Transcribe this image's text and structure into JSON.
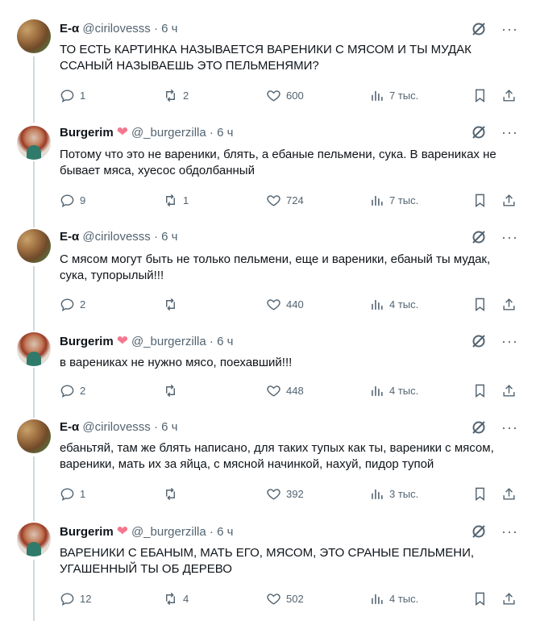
{
  "tweets": [
    {
      "name": "E-α",
      "handle": "@cirilovesss",
      "dot": "·",
      "time": "6 ч",
      "text": "ТО ЕСТЬ КАРТИНКА НАЗЫВАЕТСЯ ВАРЕНИКИ С МЯСОМ И ТЫ МУДАК ССАНЫЙ НАЗЫВАЕШЬ ЭТО ПЕЛЬМЕНЯМИ?",
      "replies": "1",
      "reposts": "2",
      "likes": "600",
      "views": "7 тыс."
    },
    {
      "name": "Burgerim",
      "handle": "@_burgerzilla",
      "dot": "·",
      "time": "6 ч",
      "text": "Потому что это не вареники, блять, а ебаные пельмени, сука. В варениках не бывает мяса, хуесос обдолбанный",
      "replies": "9",
      "reposts": "1",
      "likes": "724",
      "views": "7 тыс."
    },
    {
      "name": "E-α",
      "handle": "@cirilovesss",
      "dot": "·",
      "time": "6 ч",
      "text": "С мясом могут быть не только пельмени, еще и вареники, ебаный ты мудак, сука, тупорылый!!!",
      "replies": "2",
      "reposts": "",
      "likes": "440",
      "views": "4 тыс."
    },
    {
      "name": "Burgerim",
      "handle": "@_burgerzilla",
      "dot": "·",
      "time": "6 ч",
      "text": "в варениках не нужно мясо, поехавший!!!",
      "replies": "2",
      "reposts": "",
      "likes": "448",
      "views": "4 тыс."
    },
    {
      "name": "E-α",
      "handle": "@cirilovesss",
      "dot": "·",
      "time": "6 ч",
      "text": "ебаньтяй, там же блять написано, для таких тупых как ты, вареники с мясом, вареники, мать их за яйца, с мясной начинкой, нахуй, пидор тупой",
      "replies": "1",
      "reposts": "",
      "likes": "392",
      "views": "3 тыс."
    },
    {
      "name": "Burgerim",
      "handle": "@_burgerzilla",
      "dot": "·",
      "time": "6 ч",
      "text": "ВАРЕНИКИ С ЕБАНЫМ, МАТЬ ЕГО, МЯСОМ, ЭТО СРАНЫЕ ПЕЛЬМЕНИ, УГАШЕННЫЙ ТЫ ОБ ДЕРЕВО",
      "replies": "12",
      "reposts": "4",
      "likes": "502",
      "views": "4 тыс."
    }
  ],
  "icons": {
    "more": "···",
    "heart_emoji": "pink-heart-icon",
    "grok": "grok-icon",
    "reply": "reply-icon",
    "repost": "repost-icon",
    "like": "like-icon",
    "views": "views-icon",
    "bookmark": "bookmark-icon",
    "share": "share-icon"
  },
  "colors": {
    "text": "#0f1419",
    "secondary": "#536471",
    "thread_line": "#cfd9de",
    "heart": "#f4778e"
  }
}
